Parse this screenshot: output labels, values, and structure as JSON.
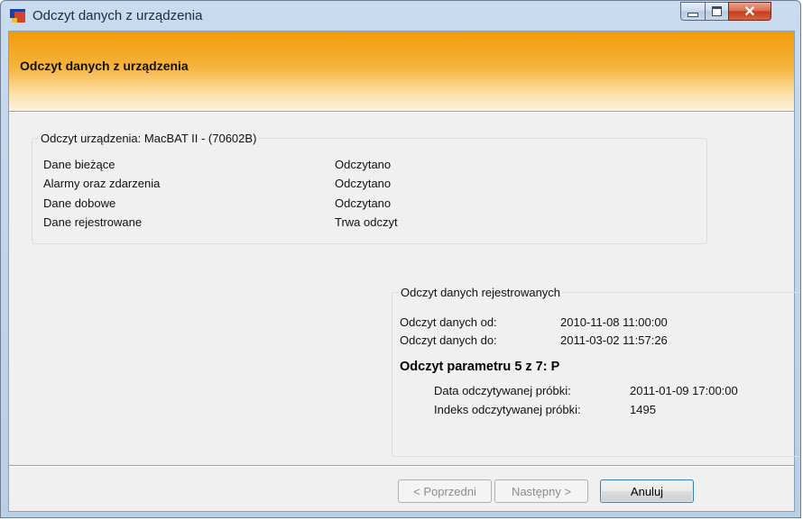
{
  "window": {
    "title": "Odczyt danych z urządzenia",
    "controls": {
      "minimize": "minimize",
      "maximize": "maximize",
      "close": "✕"
    }
  },
  "header": {
    "title": "Odczyt danych z urządzenia"
  },
  "device_group": {
    "legend": "Odczyt urządzenia: MacBAT II - (70602B)",
    "rows": [
      {
        "label": "Dane bieżące",
        "status": "Odczytano"
      },
      {
        "label": "Alarmy oraz zdarzenia",
        "status": "Odczytano"
      },
      {
        "label": "Dane dobowe",
        "status": "Odczytano"
      },
      {
        "label": "Dane rejestrowane",
        "status": "Trwa odczyt"
      }
    ]
  },
  "registered_group": {
    "legend": "Odczyt danych rejestrowanych",
    "from_label": "Odczyt danych od:",
    "from_value": "2010-11-08 11:00:00",
    "to_label": "Odczyt danych do:",
    "to_value": "2011-03-02 11:57:26",
    "parameter_line": "Odczyt parametru 5 z 7: P",
    "sample_date_label": "Data odczytywanej próbki:",
    "sample_date_value": "2011-01-09 17:00:00",
    "sample_index_label": "Indeks odczytywanej próbki:",
    "sample_index_value": "1495"
  },
  "buttons": {
    "previous": "< Poprzedni",
    "next": "Następny >",
    "cancel": "Anuluj"
  }
}
